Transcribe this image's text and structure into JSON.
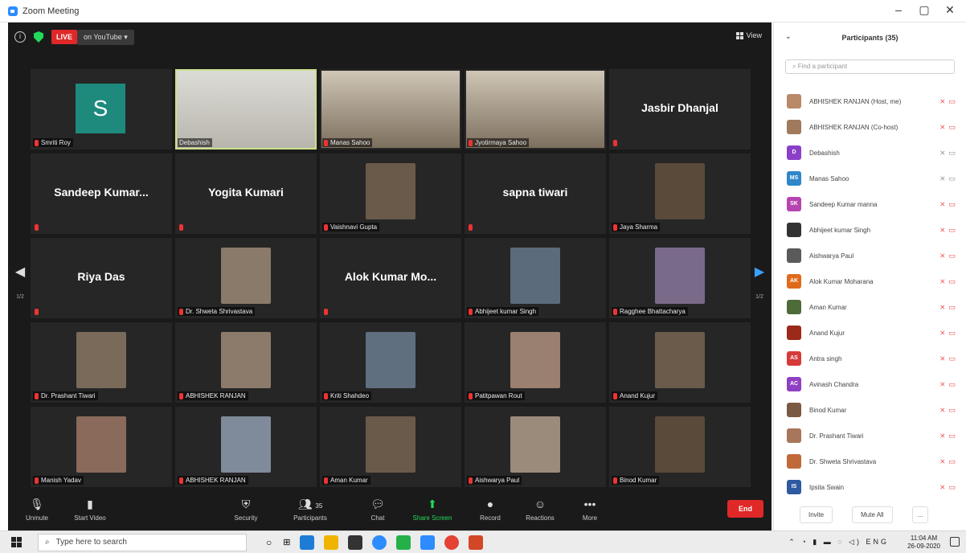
{
  "window": {
    "title": "Zoom Meeting",
    "controls": [
      "–",
      "▢",
      "✕"
    ]
  },
  "topbar": {
    "live_label": "LIVE",
    "live_dest": "on YouTube ▾",
    "view_label": "View"
  },
  "tiles": [
    {
      "name": "Smriti Roy",
      "type": "avatar",
      "initial": "S"
    },
    {
      "name": "Debashish",
      "type": "video",
      "active": true
    },
    {
      "name": "Manas Sahoo",
      "type": "video"
    },
    {
      "name": "Jyotirmaya Sahoo",
      "type": "video"
    },
    {
      "name": "",
      "type": "text",
      "big": "Jasbir Dhanjal"
    },
    {
      "name": "",
      "type": "text",
      "big": "Sandeep Kumar..."
    },
    {
      "name": "",
      "type": "text",
      "big": "Yogita Kumari"
    },
    {
      "name": "Vaishnavi Gupta",
      "type": "photo"
    },
    {
      "name": "",
      "type": "text",
      "big": "sapna tiwari"
    },
    {
      "name": "Jaya Sharma",
      "type": "photo"
    },
    {
      "name": "",
      "type": "text",
      "big": "Riya Das"
    },
    {
      "name": "Dr. Shweta Shrivastava",
      "type": "photo"
    },
    {
      "name": "",
      "type": "text",
      "big": "Alok Kumar Mo..."
    },
    {
      "name": "Abhijeet kumar Singh",
      "type": "photo"
    },
    {
      "name": "Ragghee Bhattacharya",
      "type": "photo"
    },
    {
      "name": "Dr. Prashant Tiwari",
      "type": "photo"
    },
    {
      "name": "ABHISHEK RANJAN",
      "type": "photo"
    },
    {
      "name": "Kriti Shahdeo",
      "type": "photo"
    },
    {
      "name": "Patitpawan Rout",
      "type": "photo"
    },
    {
      "name": "Anand Kujur",
      "type": "photo"
    },
    {
      "name": "Manish Yadav",
      "type": "photo"
    },
    {
      "name": "ABHISHEK RANJAN",
      "type": "photo"
    },
    {
      "name": "Aman Kumar",
      "type": "photo"
    },
    {
      "name": "Aishwarya Paul",
      "type": "photo"
    },
    {
      "name": "Binod Kumar",
      "type": "photo"
    }
  ],
  "pager": {
    "left": "1/2",
    "right": "1/2"
  },
  "toolbar": {
    "unmute": "Unmute",
    "start_video": "Start Video",
    "security": "Security",
    "participants": "Participants",
    "participants_count": "35",
    "chat": "Chat",
    "share_screen": "Share Screen",
    "record": "Record",
    "reactions": "Reactions",
    "more": "More",
    "end": "End"
  },
  "panel": {
    "title": "Participants (35)",
    "search_placeholder": "Find a participant",
    "invite": "Invite",
    "mute_all": "Mute All",
    "more": "..."
  },
  "participants": [
    {
      "name": "ABHISHEK RANJAN (Host, me)",
      "initials": "",
      "color": "#b9896a",
      "muted": true
    },
    {
      "name": "ABHISHEK RANJAN (Co-host)",
      "initials": "",
      "color": "#a07a5c",
      "muted": true
    },
    {
      "name": "Debashish",
      "initials": "D",
      "color": "#8b3fc9",
      "muted": false
    },
    {
      "name": "Manas Sahoo",
      "initials": "MS",
      "color": "#2f86c8",
      "muted": false
    },
    {
      "name": "Sandeep Kumar manna",
      "initials": "SK",
      "color": "#b644b0",
      "muted": true
    },
    {
      "name": "Abhijeet kumar Singh",
      "initials": "",
      "color": "#333333",
      "muted": true
    },
    {
      "name": "Aishwarya Paul",
      "initials": "",
      "color": "#5a5a5a",
      "muted": true
    },
    {
      "name": "Alok Kumar Moharana",
      "initials": "AK",
      "color": "#e06a1c",
      "muted": true
    },
    {
      "name": "Aman Kumar",
      "initials": "",
      "color": "#4e6b3a",
      "muted": true
    },
    {
      "name": "Anand Kujur",
      "initials": "",
      "color": "#9b2a1a",
      "muted": true
    },
    {
      "name": "Antra singh",
      "initials": "AS",
      "color": "#d63a3a",
      "muted": true
    },
    {
      "name": "Avinash Chandra",
      "initials": "AC",
      "color": "#8f3fc4",
      "muted": true
    },
    {
      "name": "Binod Kumar",
      "initials": "",
      "color": "#7a5a42",
      "muted": true
    },
    {
      "name": "Dr. Prashant Tiwari",
      "initials": "",
      "color": "#a8765a",
      "muted": true
    },
    {
      "name": "Dr. Shweta Shrivastava",
      "initials": "",
      "color": "#c06a3a",
      "muted": true
    },
    {
      "name": "Ipsita Swain",
      "initials": "IS",
      "color": "#2d5aa0",
      "muted": true
    }
  ],
  "taskbar": {
    "search_placeholder": "Type here to search",
    "time": "11:04 AM",
    "date": "26-09-2020",
    "lang": "ENG"
  }
}
